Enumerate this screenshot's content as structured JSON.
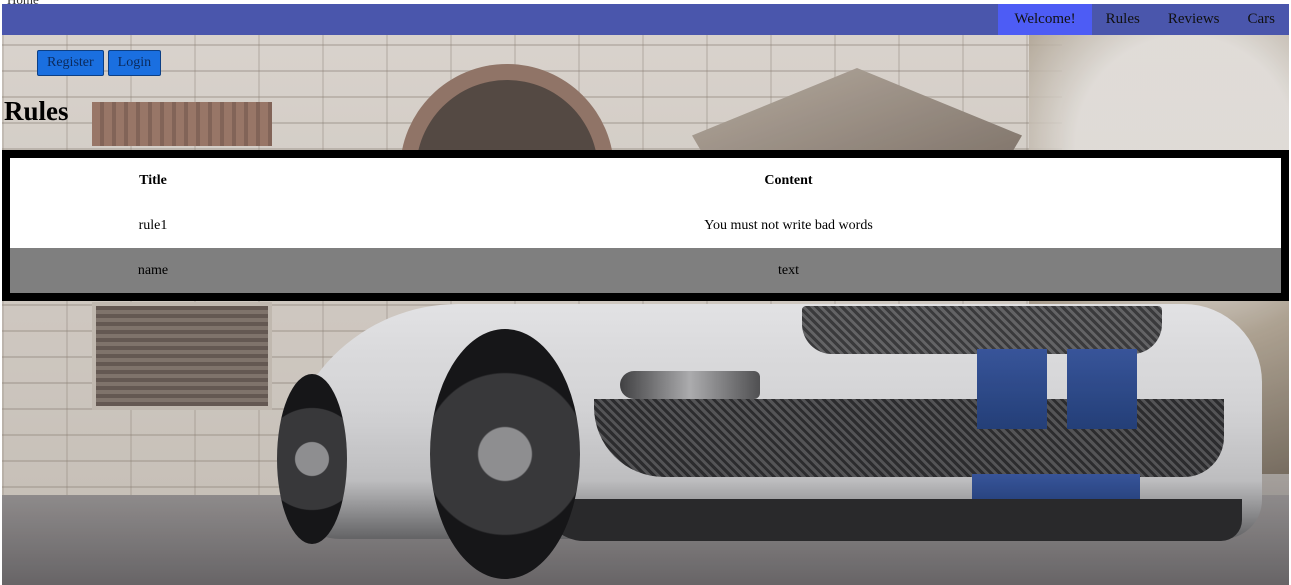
{
  "nav": {
    "brand": "Home",
    "items": [
      {
        "label": "Welcome!",
        "active": true
      },
      {
        "label": "Rules",
        "active": false
      },
      {
        "label": "Reviews",
        "active": false
      },
      {
        "label": "Cars",
        "active": false
      }
    ]
  },
  "auth": {
    "register_label": "Register",
    "login_label": "Login"
  },
  "page": {
    "title": "Rules"
  },
  "table": {
    "headers": [
      "Title",
      "Content"
    ],
    "rows": [
      [
        "rule1",
        "You must not write bad words"
      ],
      [
        "name",
        "text"
      ]
    ]
  },
  "colors": {
    "navbar": "#4a56ac",
    "nav_active": "#4d5cf5",
    "button": "#1a6fe0",
    "table_border": "#000000",
    "alt_row": "#7f7f7f"
  }
}
